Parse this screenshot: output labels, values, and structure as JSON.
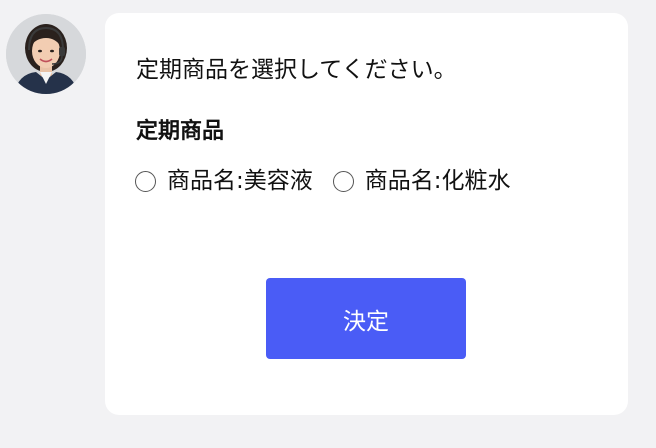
{
  "agent": {
    "avatar_icon": "operator-headset-avatar"
  },
  "message": {
    "prompt": "定期商品を選択してください。",
    "section_title": "定期商品",
    "options": [
      {
        "label": "商品名:美容液",
        "selected": false
      },
      {
        "label": "商品名:化粧水",
        "selected": false
      }
    ],
    "submit_label": "決定"
  },
  "colors": {
    "page_background": "#f2f2f4",
    "card_background": "#ffffff",
    "button_background": "#4a5cf6",
    "button_text": "#ffffff"
  }
}
